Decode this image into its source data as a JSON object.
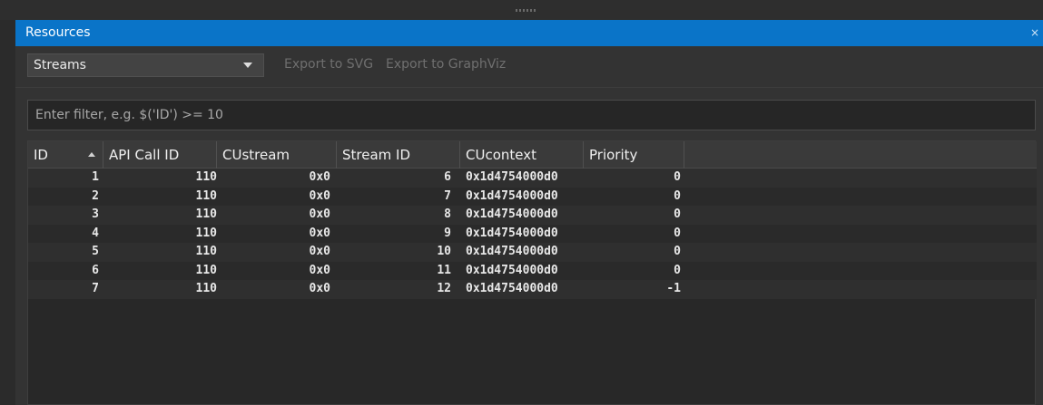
{
  "panel": {
    "title": "Resources",
    "close_glyph": "×"
  },
  "toolbar": {
    "dropdown_value": "Streams",
    "export_svg": "Export to SVG",
    "export_graphviz": "Export to GraphViz"
  },
  "filter": {
    "placeholder": "Enter filter, e.g. $('ID') >= 10"
  },
  "table": {
    "sort_column": "ID",
    "sort_direction": "ascending",
    "columns": [
      "ID",
      "API Call ID",
      "CUstream",
      "Stream ID",
      "CUcontext",
      "Priority"
    ],
    "rows": [
      [
        "1",
        "110",
        "0x0",
        "6",
        "0x1d4754000d0",
        "0"
      ],
      [
        "2",
        "110",
        "0x0",
        "7",
        "0x1d4754000d0",
        "0"
      ],
      [
        "3",
        "110",
        "0x0",
        "8",
        "0x1d4754000d0",
        "0"
      ],
      [
        "4",
        "110",
        "0x0",
        "9",
        "0x1d4754000d0",
        "0"
      ],
      [
        "5",
        "110",
        "0x0",
        "10",
        "0x1d4754000d0",
        "0"
      ],
      [
        "6",
        "110",
        "0x0",
        "11",
        "0x1d4754000d0",
        "0"
      ],
      [
        "7",
        "110",
        "0x0",
        "12",
        "0x1d4754000d0",
        "-1"
      ]
    ]
  },
  "colors": {
    "titlebar": "#0a74c8",
    "background": "#333333",
    "disabled_text": "#6f6f6f"
  }
}
